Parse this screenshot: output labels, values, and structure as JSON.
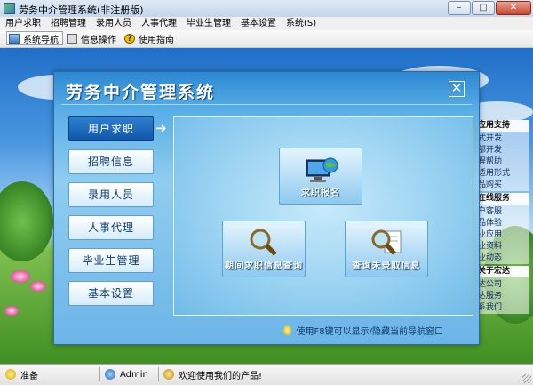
{
  "window": {
    "title": "劳务中介管理系统(非注册版)",
    "controls": {
      "minimize": "–",
      "maximize": "□",
      "close": "✕"
    }
  },
  "menubar": {
    "items": [
      "用户求职",
      "招聘管理",
      "录用人员",
      "人事代理",
      "毕业生管理",
      "基本设置",
      "系统(S)"
    ]
  },
  "toolbar": {
    "items": [
      {
        "label": "系统导航",
        "icon": "navigation-icon",
        "active": true
      },
      {
        "label": "信息操作",
        "icon": "info-icon",
        "active": false
      },
      {
        "label": "使用指南",
        "icon": "help-icon",
        "active": false
      }
    ]
  },
  "background_panel": {
    "sections": [
      {
        "heading": "应用支持",
        "items": [
          "式开发",
          "部开发",
          "程帮助",
          "适用形式",
          "品购买"
        ]
      },
      {
        "heading": "在线服务",
        "items": [
          "户客服",
          "品体验",
          "业应用",
          "业资料",
          "业动态"
        ]
      },
      {
        "heading": "关于宏达",
        "items": [
          "达公司",
          "达服务",
          "系我们"
        ]
      }
    ],
    "footer": "宏达位公司"
  },
  "dialog": {
    "title": "劳务中介管理系统",
    "close_label": "✕",
    "nav": [
      {
        "label": "用户求职",
        "active": true
      },
      {
        "label": "招聘信息",
        "active": false
      },
      {
        "label": "录用人员",
        "active": false
      },
      {
        "label": "人事代理",
        "active": false
      },
      {
        "label": "毕业生管理",
        "active": false
      },
      {
        "label": "基本设置",
        "active": false
      }
    ],
    "arrow": "➜",
    "cards": [
      {
        "label": "求职报名",
        "icon": "computer-globe-icon"
      },
      {
        "label": "期间求职信息查询",
        "icon": "magnifier-icon"
      },
      {
        "label": "查询未录取信息",
        "icon": "magnifier-document-icon"
      }
    ],
    "tip": "使用F8键可以显示/隐藏当前导航窗口"
  },
  "statusbar": {
    "ready": "准备",
    "user": "Admin",
    "welcome": "欢迎使用我们的产品!"
  }
}
